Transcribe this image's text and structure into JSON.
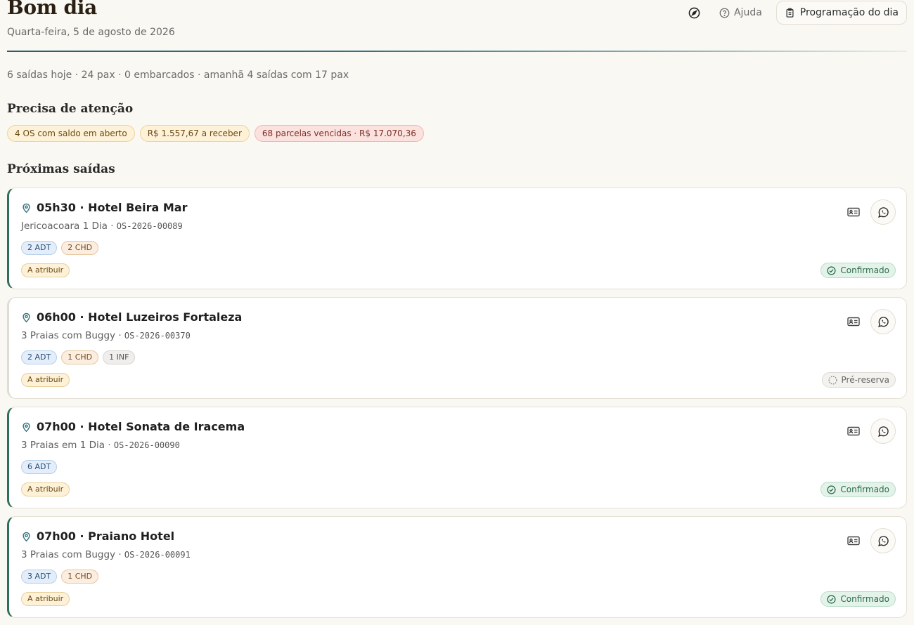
{
  "header": {
    "greeting": "Bom dia",
    "date": "Quarta-feira, 5 de agosto de 2026",
    "help_label": "Ajuda",
    "schedule_label": "Programação do dia"
  },
  "summary": "6 saídas hoje · 24 pax · 0 embarcados · amanhã 4 saídas com 17 pax",
  "attention": {
    "title": "Precisa de atenção",
    "alerts": [
      {
        "label": "4 OS com saldo em aberto",
        "tone": "warning"
      },
      {
        "label": "R$ 1.557,67 a receber",
        "tone": "warning"
      },
      {
        "label": "68 parcelas vencidas · R$ 17.070,36",
        "tone": "danger"
      }
    ]
  },
  "departures": {
    "title": "Próximas saídas",
    "cards": [
      {
        "title": "05h30 · Hotel Beira Mar",
        "tour": "Jericoacoara 1 Dia",
        "code": "OS-2026-00089",
        "pax": [
          {
            "label": "2 ADT",
            "type": "adt"
          },
          {
            "label": "2 CHD",
            "type": "chd"
          }
        ],
        "assign": "A atribuir",
        "status": "Confirmado",
        "status_type": "confirmed"
      },
      {
        "title": "06h00 · Hotel Luzeiros Fortaleza",
        "tour": "3 Praias com Buggy",
        "code": "OS-2026-00370",
        "pax": [
          {
            "label": "2 ADT",
            "type": "adt"
          },
          {
            "label": "1 CHD",
            "type": "chd"
          },
          {
            "label": "1 INF",
            "type": "inf"
          }
        ],
        "assign": "A atribuir",
        "status": "Pré-reserva",
        "status_type": "pre"
      },
      {
        "title": "07h00 · Hotel Sonata de Iracema",
        "tour": "3 Praias em 1 Dia",
        "code": "OS-2026-00090",
        "pax": [
          {
            "label": "6 ADT",
            "type": "adt"
          }
        ],
        "assign": "A atribuir",
        "status": "Confirmado",
        "status_type": "confirmed"
      },
      {
        "title": "07h00 · Praiano Hotel",
        "tour": "3 Praias com Buggy",
        "code": "OS-2026-00091",
        "pax": [
          {
            "label": "3 ADT",
            "type": "adt"
          },
          {
            "label": "1 CHD",
            "type": "chd"
          }
        ],
        "assign": "A atribuir",
        "status": "Confirmado",
        "status_type": "confirmed"
      }
    ]
  },
  "icons": {
    "compass": "compass-icon",
    "help": "help-circle-icon",
    "clipboard": "clipboard-icon",
    "location": "map-pin-icon",
    "id_card": "id-card-icon",
    "whatsapp": "whatsapp-icon",
    "confirmed": "check-circle-icon",
    "pre": "dashed-circle-icon"
  },
  "colors": {
    "background": "#faf8f3",
    "accent": "#2f6f57",
    "warning_bg": "#fdf1d8",
    "danger_bg": "#fbe2df",
    "confirmed_bg": "#e4f3ea"
  }
}
